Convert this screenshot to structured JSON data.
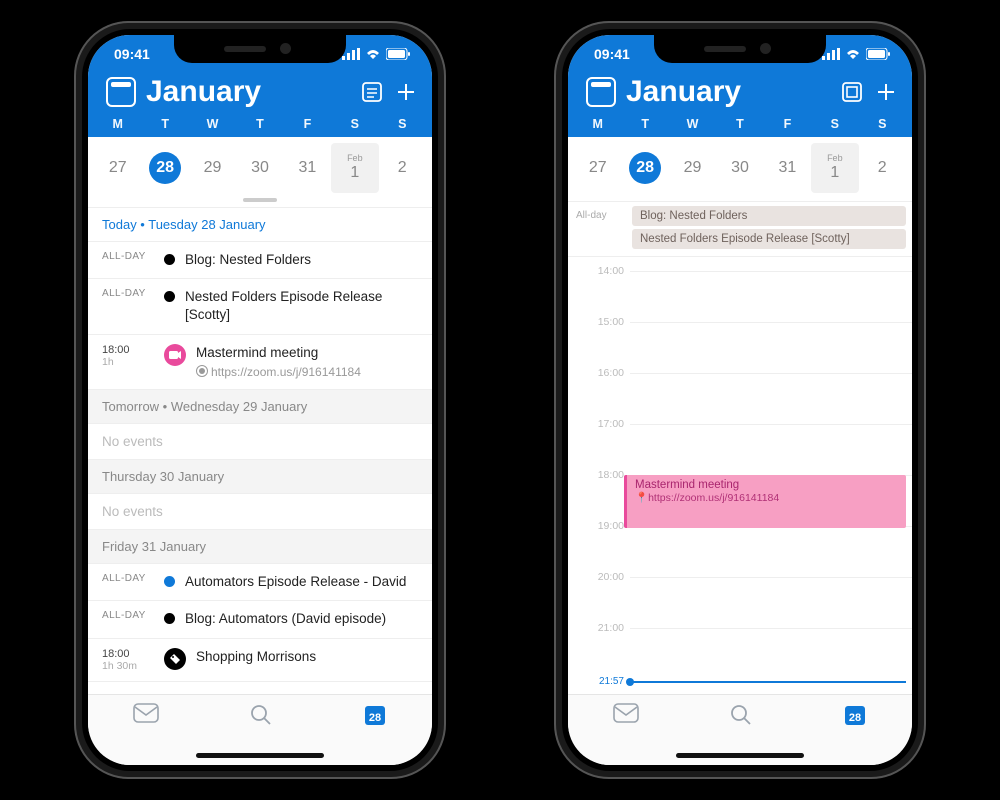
{
  "status": {
    "time": "09:41"
  },
  "header": {
    "month": "January"
  },
  "week": {
    "labels": [
      "M",
      "T",
      "W",
      "T",
      "F",
      "S",
      "S"
    ],
    "days": [
      {
        "n": "27"
      },
      {
        "n": "28",
        "selected": true
      },
      {
        "n": "29"
      },
      {
        "n": "30"
      },
      {
        "n": "31"
      },
      {
        "m": "Feb",
        "n": "1",
        "shade": true
      },
      {
        "n": "2"
      }
    ]
  },
  "agenda": {
    "sections": [
      {
        "label": "Today • Tuesday 28 January",
        "today": true,
        "events": [
          {
            "time": "ALL-DAY",
            "dot": "#000",
            "title": "Blog: Nested Folders"
          },
          {
            "time": "ALL-DAY",
            "dot": "#000",
            "title": "Nested Folders Episode Release [Scotty]"
          },
          {
            "time": "18:00",
            "dur": "1h",
            "icon_bg": "#e94a9c",
            "icon": "camera",
            "title": "Mastermind meeting",
            "loc": "https://zoom.us/j/916141184"
          }
        ]
      },
      {
        "label": "Tomorrow • Wednesday 29 January",
        "events": "none"
      },
      {
        "label": "Thursday 30 January",
        "events": "none"
      },
      {
        "label": "Friday 31 January",
        "events": [
          {
            "time": "ALL-DAY",
            "dot": "#0f79d8",
            "title": "Automators Episode Release - David"
          },
          {
            "time": "ALL-DAY",
            "dot": "#000",
            "title": "Blog: Automators (David episode)"
          },
          {
            "time": "18:00",
            "dur": "1h 30m",
            "icon_bg": "#000",
            "icon": "tag",
            "title": "Shopping Morrisons"
          }
        ]
      }
    ],
    "no_events_label": "No events"
  },
  "timeline": {
    "allday_label": "All-day",
    "allday": [
      {
        "title": "Blog: Nested Folders"
      },
      {
        "title": "Nested Folders Episode Release [Scotty]"
      }
    ],
    "hours": [
      "14:00",
      "15:00",
      "16:00",
      "17:00",
      "18:00",
      "19:00",
      "20:00",
      "21:00"
    ],
    "event": {
      "start": "18:00",
      "title": "Mastermind meeting",
      "loc": "https://zoom.us/j/916141184"
    },
    "now": "21:57"
  },
  "tabbar": {
    "cal_badge": "28"
  }
}
